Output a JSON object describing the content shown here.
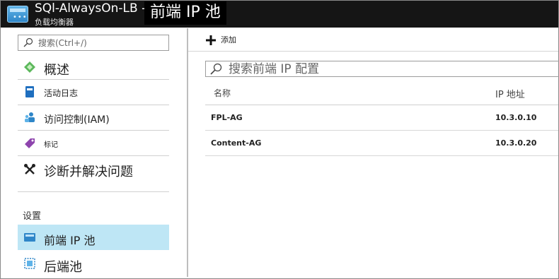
{
  "header": {
    "title": "SQl-AlwaysOn-LB -",
    "subtitle": "负载均衡器",
    "overlay_title": "前端 IP 池",
    "icon": "load-balancer-icon"
  },
  "sidebar": {
    "search_placeholder": "搜索(Ctrl+/)",
    "items": [
      {
        "label": "概述",
        "icon": "overview-diamond-icon"
      },
      {
        "label": "活动日志",
        "icon": "activity-log-icon"
      },
      {
        "label": "访问控制(IAM)",
        "icon": "people-icon"
      },
      {
        "label": "标记",
        "icon": "tag-icon"
      },
      {
        "label": "诊断并解决问题",
        "icon": "wrench-icon"
      }
    ],
    "section_label": "设置",
    "settings_items": [
      {
        "label": "前端 IP 池",
        "icon": "frontend-ip-icon",
        "selected": true
      },
      {
        "label": "后端池",
        "icon": "backend-pool-icon",
        "selected": false
      }
    ]
  },
  "main": {
    "toolbar": {
      "add_label": "添加",
      "add_icon": "plus-icon"
    },
    "filter_placeholder": "搜索前端 IP 配置",
    "table": {
      "columns": [
        "名称",
        "IP 地址"
      ],
      "rows": [
        [
          "FPL-AG",
          "10.3.0.10"
        ],
        [
          "Content-AG",
          "10.3.0.20"
        ]
      ]
    }
  },
  "colors": {
    "topbar_bg": "#151515",
    "selected_bg": "#bee6f5",
    "accent_blue": "#2f86c8"
  }
}
